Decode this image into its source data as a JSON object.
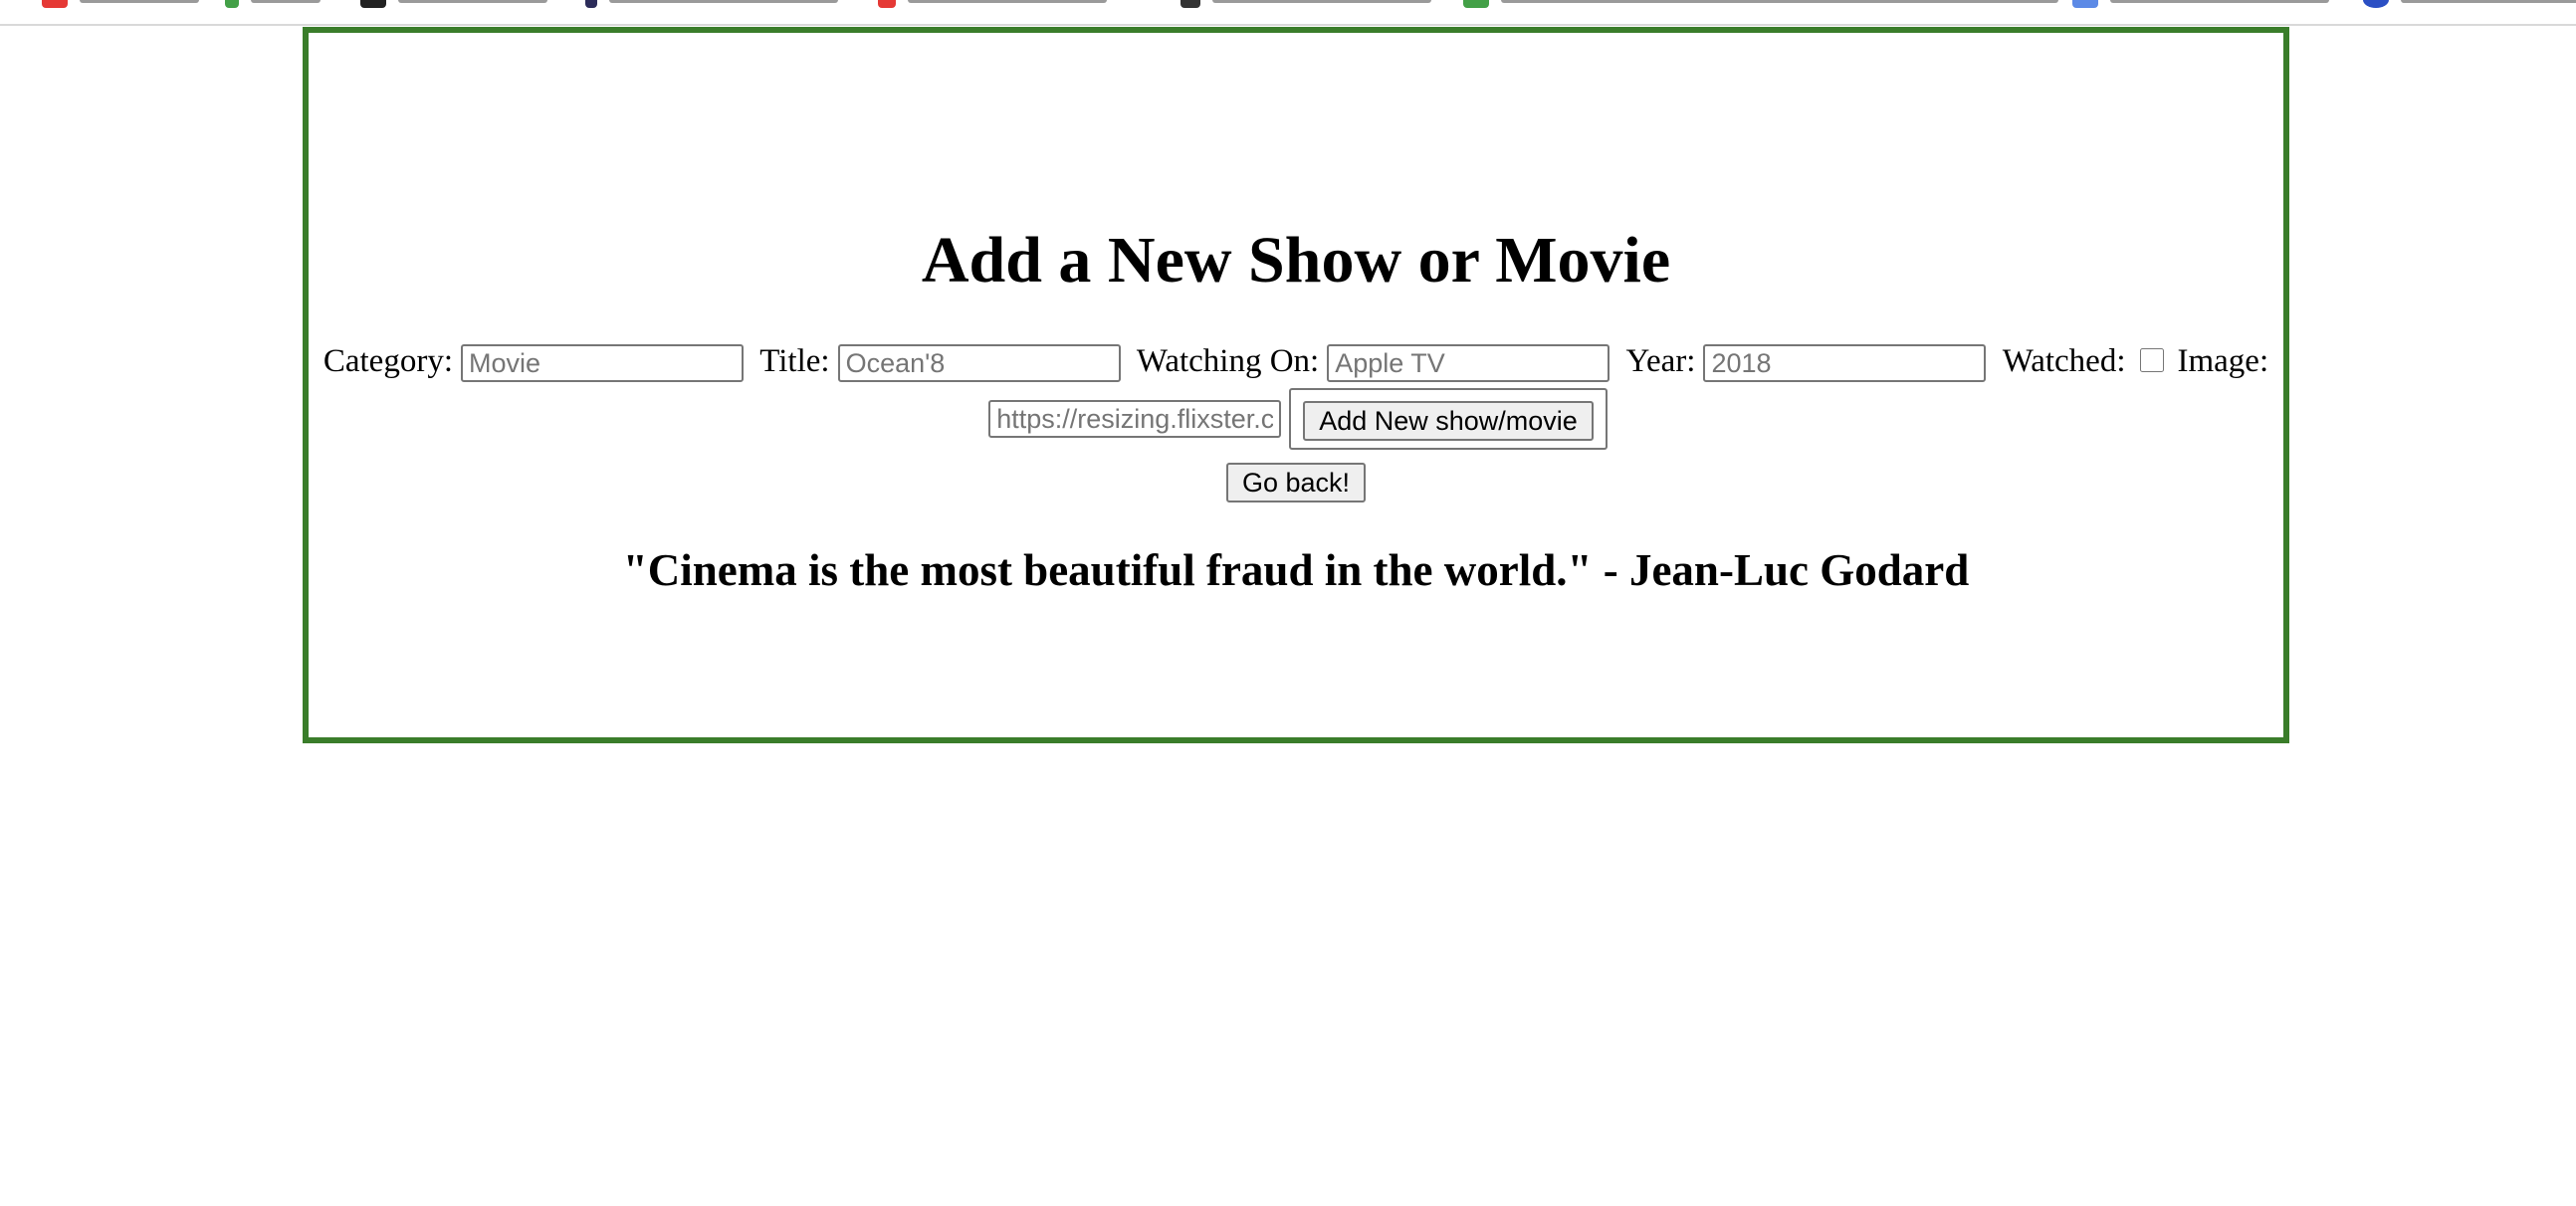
{
  "heading": "Add a New Show or Movie",
  "form": {
    "category_label": "Category:",
    "category_placeholder": "Movie",
    "title_label": "Title:",
    "title_placeholder": "Ocean'8",
    "watching_on_label": "Watching On:",
    "watching_on_placeholder": "Apple TV",
    "year_label": "Year:",
    "year_placeholder": "2018",
    "watched_label": "Watched:",
    "image_label": "Image:",
    "image_placeholder": "https://resizing.flixster.co",
    "submit_label": "Add New show/movie"
  },
  "back_button_label": "Go back!",
  "quote": "\"Cinema is the most beautiful fraud in the world.\" - Jean-Luc Godard",
  "colors": {
    "border": "#3a7d2a"
  }
}
